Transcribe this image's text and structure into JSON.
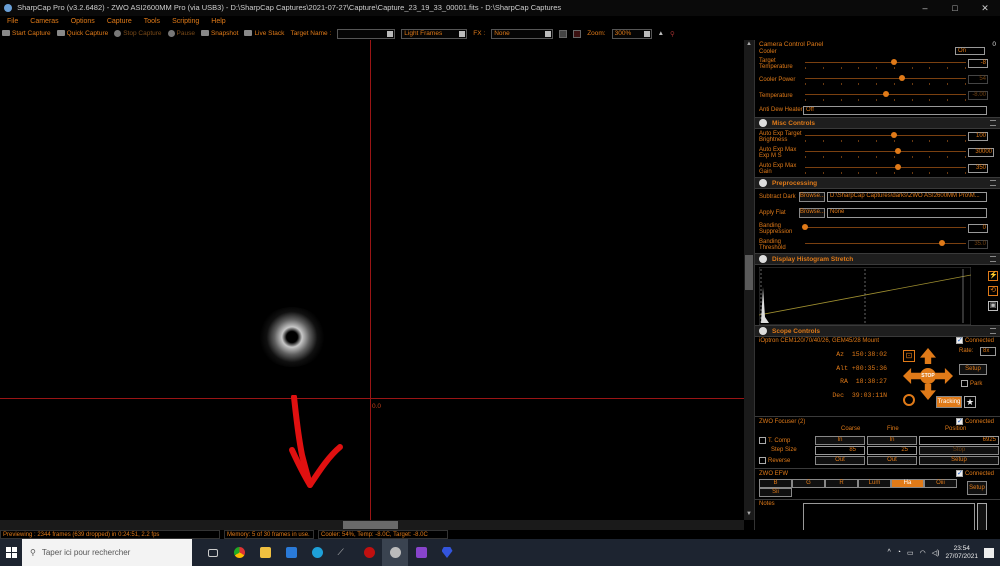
{
  "window": {
    "title": "SharpCap Pro (v3.2.6482) - ZWO ASI2600MM Pro (via USB3) - D:\\SharpCap Captures\\2021-07-27\\Capture\\Capture_23_19_33_00001.fits - D:\\SharpCap Captures",
    "controls": [
      "–",
      "□",
      "✕"
    ]
  },
  "menu": [
    "File",
    "Cameras",
    "Options",
    "Capture",
    "Tools",
    "Scripting",
    "Help"
  ],
  "toolbar": {
    "start_capture": "Start Capture",
    "quick_capture": "Quick Capture",
    "stop_capture": "Stop Capture",
    "pause": "Pause",
    "snapshot": "Snapshot",
    "live_stack": "Live Stack",
    "target_name_label": "Target Name :",
    "target_name_value": "",
    "frame_type": "Light Frames",
    "fx_label": "FX :",
    "fx_value": "None",
    "zoom_label": "Zoom:",
    "zoom_value": "300%"
  },
  "preview": {
    "crosshair_label": "0.0"
  },
  "panel": {
    "camera_control_title": "Camera Control Panel",
    "camera_control_count": "0",
    "cooler_label": "Cooler",
    "cooler_value": "On",
    "target_temperature_label": "Target Temperature",
    "target_temperature_value": "-8",
    "target_temperature_pos": 0.55,
    "cooler_power_label": "Cooler Power",
    "cooler_power_value": "54",
    "cooler_power_pos": 0.6,
    "temperature_label": "Temperature",
    "temperature_value": "-8.00",
    "temperature_pos": 0.5,
    "anti_dew_label": "Anti Dew Heater",
    "anti_dew_value": "Off",
    "misc_title": "Misc Controls",
    "auto_exp_brightness_label": "Auto Exp Target Brightness",
    "auto_exp_brightness_value": "100",
    "auto_exp_brightness_pos": 0.55,
    "auto_exp_max_ms_label": "Auto Exp Max Exp M S",
    "auto_exp_max_ms_value": "30000",
    "auto_exp_max_ms_pos": 0.58,
    "auto_exp_max_gain_label": "Auto Exp Max Gain",
    "auto_exp_max_gain_value": "350",
    "auto_exp_max_gain_pos": 0.58,
    "preprocessing_title": "Preprocessing",
    "subtract_dark_label": "Subtract Dark",
    "subtract_dark_browse": "Browse...",
    "subtract_dark_value": "D:\\SharpCap Captures\\darks\\ZWO ASI2600MM Pro\\M...",
    "apply_flat_label": "Apply Flat",
    "apply_flat_browse": "Browse...",
    "apply_flat_value": "None",
    "banding_suppression_label": "Banding Suppression",
    "banding_suppression_value": "0",
    "banding_suppression_pos": 0.0,
    "banding_threshold_label": "Banding Threshold",
    "banding_threshold_value": "35.0",
    "banding_threshold_pos": 0.85,
    "histogram_title": "Display Histogram Stretch",
    "scope_title": "Scope Controls",
    "mount_name": "iOptron CEM120/70/40/26, GEM45/28 Mount",
    "mount_connected": "Connected",
    "az_label": "Az",
    "az_value": "150:38:02",
    "alt_label": "Alt",
    "alt_value": "+80:35:36",
    "ra_label": "RA",
    "ra_value": "18:38:27",
    "dec_label": "Dec",
    "dec_value": "39:03:11N",
    "rate_label": "Rate:",
    "rate_value": "8x",
    "setup_button": "Setup",
    "park_label": "Park",
    "stop_label": "STOP",
    "tracking_button": "Tracking",
    "focuser_title": "ZWO Focuser (2)",
    "focuser_connected": "Connected",
    "coarse_label": "Coarse",
    "fine_label": "Fine",
    "position_label": "Position",
    "t_comp_label": "T. Comp",
    "in_coarse": "In",
    "in_fine": "In",
    "position_value": "6925",
    "step_size_label": "Step Size",
    "step_coarse": "85",
    "step_fine": "25",
    "stop_button": "Stop",
    "reverse_label": "Reverse",
    "out_coarse": "Out",
    "out_fine": "Out",
    "focuser_setup": "Setup",
    "efw_title": "ZWO EFW",
    "efw_connected": "Connected",
    "filters": [
      "B",
      "G",
      "R",
      "Lum",
      "Ha",
      "Oiii",
      "Sii"
    ],
    "efw_setup": "Setup",
    "notes_label": "Notes"
  },
  "status": {
    "previewing": "Previewing : 2344 frames (639 dropped) in 0:24:51, 2.2 fps",
    "memory": "Memory: 5 of 30 frames in use.",
    "cooler": "Cooler: 54%, Temp: -8.0C, Target: -8.0C"
  },
  "taskbar": {
    "search_placeholder": "Taper ici pour rechercher",
    "time": "23:54",
    "date": "27/07/2021"
  },
  "colors": {
    "accent": "#e07a18",
    "crosshair": "#9a1515",
    "annotation_arrow": "#e01010"
  }
}
